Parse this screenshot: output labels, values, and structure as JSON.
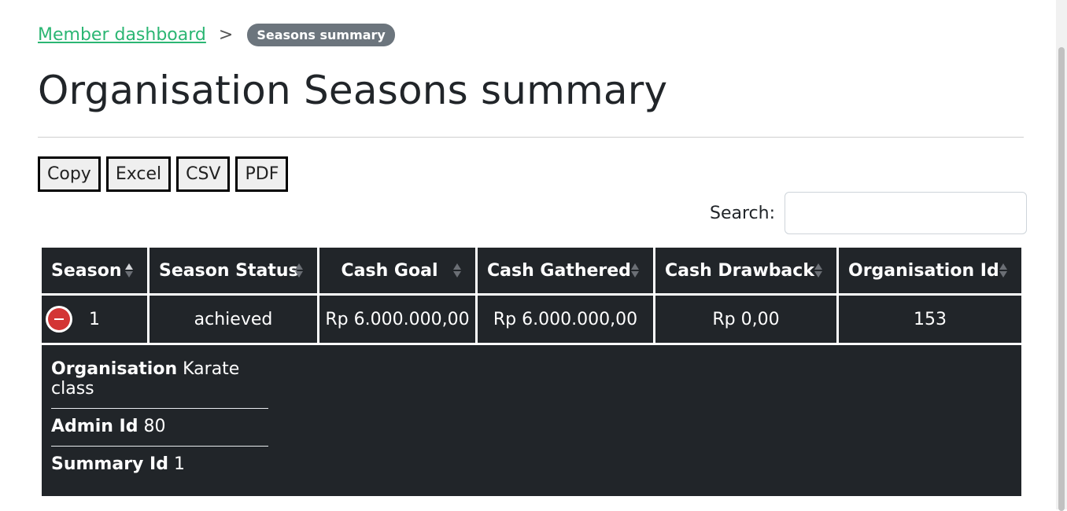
{
  "breadcrumb": {
    "link": "Member dashboard",
    "separator": ">",
    "current": "Seasons summary"
  },
  "page_title": "Organisation Seasons summary",
  "export_buttons": [
    "Copy",
    "Excel",
    "CSV",
    "PDF"
  ],
  "search": {
    "label": "Search:",
    "value": "",
    "placeholder": ""
  },
  "table": {
    "columns": [
      "Season",
      "Season Status",
      "Cash Goal",
      "Cash Gathered",
      "Cash Drawback",
      "Organisation Id"
    ],
    "sorted_column": "Season",
    "rows": [
      {
        "season": "1",
        "status": "achieved",
        "cash_goal": "Rp 6.000.000,00",
        "cash_gathered": "Rp 6.000.000,00",
        "cash_drawback": "Rp 0,00",
        "organisation_id": "153",
        "details": [
          {
            "label": "Organisation",
            "value": "Karate class"
          },
          {
            "label": "Admin Id",
            "value": "80"
          },
          {
            "label": "Summary Id",
            "value": "1"
          }
        ]
      }
    ]
  },
  "icons": {
    "collapse": "minus-circle-icon",
    "sort": "sort-arrows-icon",
    "separator": "chevron-right-icon"
  },
  "colors": {
    "link": "#2bb673",
    "badge": "#6c757d",
    "table_bg": "#212529",
    "collapse_button": "#d33535"
  }
}
